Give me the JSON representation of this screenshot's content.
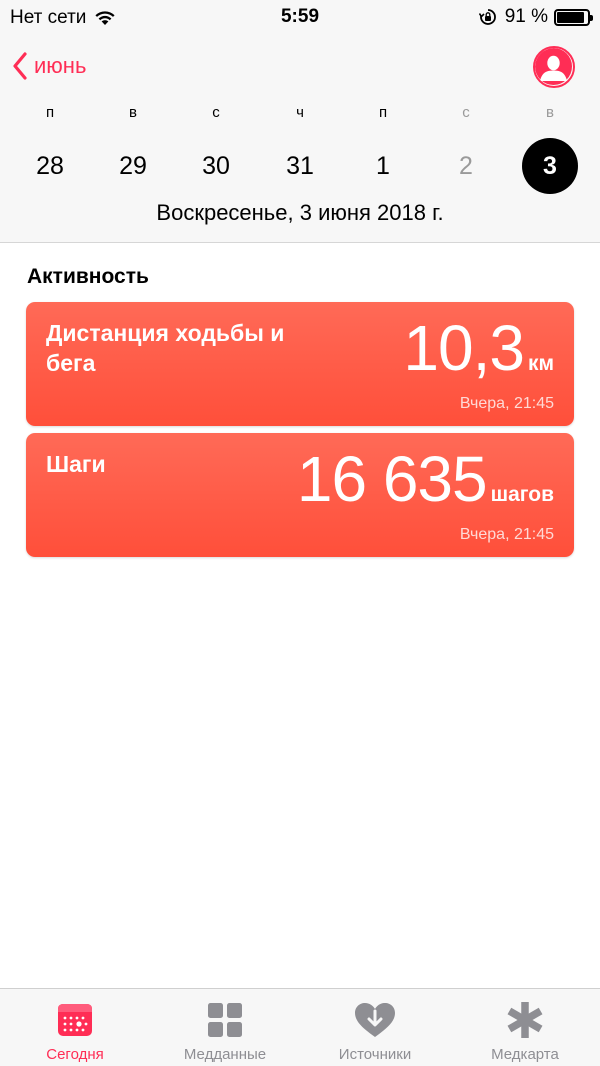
{
  "status_bar": {
    "carrier": "Нет сети",
    "time": "5:59",
    "battery_percent": "91 %",
    "battery_level": 0.91
  },
  "nav": {
    "back_label": "июнь"
  },
  "calendar": {
    "weekdays": [
      "п",
      "в",
      "с",
      "ч",
      "п",
      "с",
      "в"
    ],
    "days": [
      "28",
      "29",
      "30",
      "31",
      "1",
      "2",
      "3"
    ],
    "selected_index": 6,
    "full_date": "Воскресенье, 3 июня 2018 г."
  },
  "activity": {
    "section_title": "Активность",
    "cards": [
      {
        "title": "Дистанция ходьбы и бега",
        "value": "10,3",
        "unit": "км",
        "timestamp": "Вчера, 21:45"
      },
      {
        "title": "Шаги",
        "value": "16 635",
        "unit": "шагов",
        "timestamp": "Вчера, 21:45"
      }
    ]
  },
  "tab_bar": {
    "tabs": [
      {
        "label": "Сегодня",
        "icon": "calendar-today-icon",
        "active": true
      },
      {
        "label": "Медданные",
        "icon": "grid-icon",
        "active": false
      },
      {
        "label": "Источники",
        "icon": "heart-download-icon",
        "active": false
      },
      {
        "label": "Медкарта",
        "icon": "asterisk-icon",
        "active": false
      }
    ]
  },
  "colors": {
    "accent": "#ff2d55",
    "card_top": "#ff6a57",
    "card_bottom": "#ff4f3a",
    "inactive_tab": "#8e8e93"
  }
}
